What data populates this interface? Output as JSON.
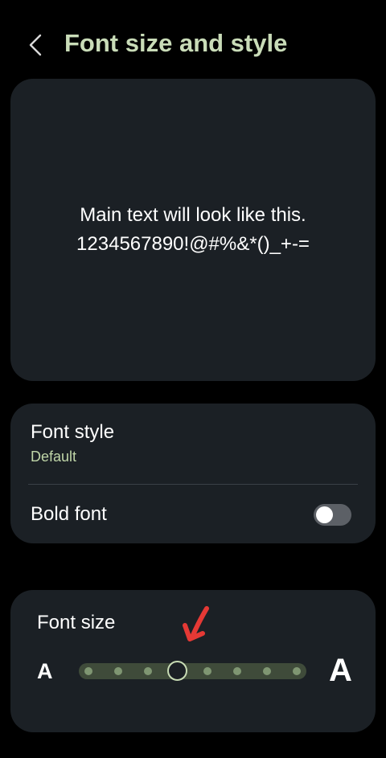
{
  "header": {
    "title": "Font size and style"
  },
  "preview": {
    "line1": "Main text will look like this.",
    "line2": "1234567890!@#%&*()_+-="
  },
  "settings": {
    "font_style": {
      "label": "Font style",
      "value": "Default"
    },
    "bold_font": {
      "label": "Bold font",
      "enabled": false
    }
  },
  "font_size": {
    "label": "Font size",
    "small_glyph": "A",
    "large_glyph": "A",
    "steps": 8,
    "current_step": 4
  },
  "colors": {
    "accent_title": "#c9dcb8",
    "subtitle_green": "#c0d6a8",
    "card_bg": "#1b2025",
    "track": "#3f4b3a",
    "annotation_arrow": "#e53935"
  },
  "icons": {
    "back": "chevron-left-icon",
    "annotation": "red-arrow-icon"
  }
}
